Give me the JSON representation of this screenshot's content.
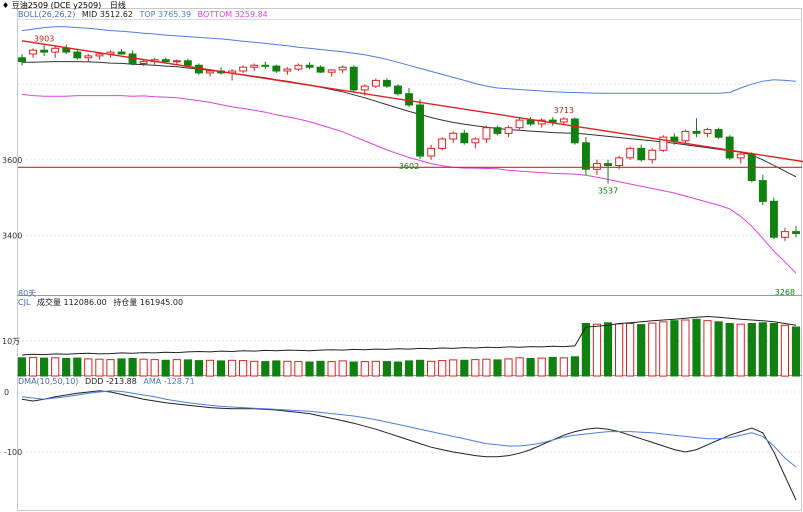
{
  "header": {
    "symbol": "♦ 豆油2509 (DCE y2509)",
    "period": "日线",
    "colors": {
      "black": "#222222"
    }
  },
  "panes": {
    "main": {
      "indicator_name": "BOLL(26,26,2)",
      "mid_label": "MID 3512.62",
      "top_label": "TOP 3765.39",
      "bottom_label": "BOTTOM 3259.84",
      "y_ticks": [
        3600,
        3400
      ],
      "ylim": [
        3250,
        3970
      ],
      "annotations": [
        {
          "text": "3903",
          "index": 2,
          "value": 3903
        },
        {
          "text": "3713",
          "index": 49,
          "value": 3713
        },
        {
          "text": "3602",
          "index": 35,
          "value": 3602
        },
        {
          "text": "3537",
          "index": 53,
          "value": 3537
        },
        {
          "text": "3268",
          "index": 69,
          "value": 3268
        }
      ],
      "horizontal_line_value": 3580,
      "trendline": {
        "start": [
          0,
          3915
        ],
        "end": [
          70,
          3595
        ]
      },
      "corner_label": "80天",
      "colors": {
        "mid": "#333333",
        "top": "#4a7fe0",
        "bottom": "#e040e0",
        "up": "#e02020",
        "down": "#108010",
        "line": "#e02020"
      }
    },
    "volume": {
      "indicator_name": "CJL",
      "vol_label": "成交量 112086.00",
      "oi_label": "持仓量 161945.00",
      "y_tick": "10万",
      "ylim": [
        0,
        200000
      ]
    },
    "dma": {
      "indicator_name": "DMA(10,50,10)",
      "ddd_label": "DDD -213.88",
      "ama_label": "AMA -128.71",
      "y_ticks": [
        0,
        -100
      ],
      "ylim": [
        -200,
        10
      ],
      "colors": {
        "ddd": "#222222",
        "ama": "#4a7fe0"
      }
    }
  },
  "chart_data": {
    "type": "candlestick",
    "candles": [
      [
        3870,
        3880,
        3850,
        3860
      ],
      [
        3880,
        3895,
        3870,
        3890
      ],
      [
        3890,
        3903,
        3875,
        3885
      ],
      [
        3885,
        3900,
        3870,
        3895
      ],
      [
        3895,
        3905,
        3880,
        3885
      ],
      [
        3885,
        3892,
        3865,
        3870
      ],
      [
        3870,
        3880,
        3860,
        3875
      ],
      [
        3875,
        3885,
        3865,
        3880
      ],
      [
        3880,
        3890,
        3870,
        3885
      ],
      [
        3885,
        3892,
        3878,
        3880
      ],
      [
        3880,
        3890,
        3850,
        3855
      ],
      [
        3855,
        3865,
        3848,
        3860
      ],
      [
        3860,
        3870,
        3852,
        3865
      ],
      [
        3865,
        3870,
        3855,
        3860
      ],
      [
        3860,
        3865,
        3850,
        3862
      ],
      [
        3862,
        3868,
        3845,
        3850
      ],
      [
        3850,
        3855,
        3825,
        3830
      ],
      [
        3830,
        3840,
        3820,
        3835
      ],
      [
        3835,
        3845,
        3825,
        3830
      ],
      [
        3830,
        3840,
        3810,
        3835
      ],
      [
        3835,
        3850,
        3830,
        3845
      ],
      [
        3845,
        3855,
        3835,
        3850
      ],
      [
        3850,
        3860,
        3840,
        3848
      ],
      [
        3848,
        3852,
        3830,
        3835
      ],
      [
        3835,
        3845,
        3825,
        3840
      ],
      [
        3840,
        3855,
        3835,
        3850
      ],
      [
        3850,
        3858,
        3840,
        3845
      ],
      [
        3845,
        3850,
        3830,
        3832
      ],
      [
        3832,
        3840,
        3820,
        3838
      ],
      [
        3838,
        3850,
        3830,
        3845
      ],
      [
        3845,
        3850,
        3780,
        3785
      ],
      [
        3785,
        3800,
        3770,
        3795
      ],
      [
        3795,
        3815,
        3790,
        3810
      ],
      [
        3810,
        3815,
        3790,
        3795
      ],
      [
        3795,
        3800,
        3770,
        3775
      ],
      [
        3775,
        3790,
        3740,
        3745
      ],
      [
        3745,
        3760,
        3602,
        3610
      ],
      [
        3610,
        3640,
        3600,
        3630
      ],
      [
        3630,
        3660,
        3625,
        3655
      ],
      [
        3655,
        3675,
        3645,
        3670
      ],
      [
        3670,
        3680,
        3640,
        3645
      ],
      [
        3645,
        3660,
        3630,
        3655
      ],
      [
        3655,
        3690,
        3645,
        3685
      ],
      [
        3685,
        3690,
        3665,
        3670
      ],
      [
        3670,
        3690,
        3660,
        3685
      ],
      [
        3685,
        3710,
        3680,
        3705
      ],
      [
        3705,
        3713,
        3690,
        3695
      ],
      [
        3695,
        3710,
        3685,
        3705
      ],
      [
        3705,
        3713,
        3690,
        3700
      ],
      [
        3700,
        3713,
        3695,
        3708
      ],
      [
        3708,
        3712,
        3640,
        3645
      ],
      [
        3645,
        3660,
        3560,
        3575
      ],
      [
        3575,
        3600,
        3560,
        3590
      ],
      [
        3590,
        3600,
        3537,
        3585
      ],
      [
        3585,
        3610,
        3575,
        3605
      ],
      [
        3605,
        3635,
        3600,
        3630
      ],
      [
        3630,
        3640,
        3595,
        3600
      ],
      [
        3600,
        3630,
        3590,
        3625
      ],
      [
        3625,
        3665,
        3620,
        3660
      ],
      [
        3660,
        3670,
        3640,
        3650
      ],
      [
        3650,
        3680,
        3640,
        3675
      ],
      [
        3675,
        3710,
        3660,
        3670
      ],
      [
        3670,
        3685,
        3660,
        3680
      ],
      [
        3680,
        3685,
        3655,
        3660
      ],
      [
        3660,
        3665,
        3600,
        3605
      ],
      [
        3605,
        3620,
        3590,
        3615
      ],
      [
        3615,
        3620,
        3540,
        3545
      ],
      [
        3545,
        3560,
        3480,
        3490
      ],
      [
        3490,
        3500,
        3390,
        3395
      ],
      [
        3395,
        3420,
        3385,
        3410
      ],
      [
        3410,
        3425,
        3395,
        3405
      ]
    ],
    "boll_mid": [
      3858,
      3858,
      3859,
      3860,
      3860,
      3860,
      3859,
      3858,
      3856,
      3855,
      3853,
      3852,
      3850,
      3848,
      3846,
      3843,
      3840,
      3837,
      3833,
      3829,
      3825,
      3821,
      3817,
      3812,
      3808,
      3803,
      3798,
      3792,
      3786,
      3780,
      3772,
      3764,
      3755,
      3746,
      3737,
      3728,
      3720,
      3712,
      3705,
      3699,
      3694,
      3690,
      3686,
      3683,
      3680,
      3678,
      3676,
      3674,
      3672,
      3671,
      3670,
      3668,
      3665,
      3662,
      3659,
      3656,
      3653,
      3650,
      3647,
      3644,
      3640,
      3636,
      3632,
      3628,
      3624,
      3620,
      3612,
      3600,
      3585,
      3570,
      3555
    ],
    "boll_top": [
      3942,
      3946,
      3950,
      3952,
      3952,
      3950,
      3948,
      3945,
      3942,
      3940,
      3938,
      3935,
      3933,
      3930,
      3928,
      3926,
      3924,
      3922,
      3920,
      3917,
      3914,
      3911,
      3908,
      3905,
      3902,
      3898,
      3895,
      3892,
      3889,
      3886,
      3882,
      3878,
      3872,
      3866,
      3858,
      3850,
      3842,
      3834,
      3826,
      3818,
      3810,
      3802,
      3795,
      3790,
      3788,
      3786,
      3784,
      3782,
      3780,
      3779,
      3778,
      3777,
      3776,
      3776,
      3776,
      3776,
      3776,
      3776,
      3776,
      3776,
      3776,
      3776,
      3776,
      3776,
      3778,
      3790,
      3800,
      3808,
      3812,
      3810,
      3808
    ],
    "boll_bottom": [
      3773,
      3770,
      3768,
      3768,
      3768,
      3770,
      3770,
      3770,
      3770,
      3770,
      3768,
      3769,
      3767,
      3766,
      3764,
      3760,
      3756,
      3752,
      3746,
      3740,
      3736,
      3731,
      3726,
      3719,
      3714,
      3708,
      3701,
      3692,
      3683,
      3674,
      3662,
      3650,
      3638,
      3626,
      3616,
      3606,
      3598,
      3590,
      3584,
      3580,
      3578,
      3578,
      3577,
      3576,
      3572,
      3570,
      3568,
      3566,
      3564,
      3563,
      3562,
      3559,
      3554,
      3548,
      3542,
      3536,
      3530,
      3524,
      3518,
      3512,
      3504,
      3496,
      3488,
      3480,
      3470,
      3450,
      3424,
      3392,
      3358,
      3330,
      3300
    ],
    "volume": [
      52000,
      53000,
      51000,
      52000,
      50000,
      51000,
      49000,
      48000,
      47000,
      49000,
      50000,
      48000,
      47000,
      45000,
      47000,
      46000,
      44000,
      45000,
      43000,
      45000,
      44000,
      42000,
      41000,
      43000,
      42000,
      41000,
      40000,
      42000,
      41000,
      43000,
      40000,
      41000,
      42000,
      41000,
      40000,
      43000,
      45000,
      42000,
      44000,
      46000,
      45000,
      47000,
      48000,
      46000,
      49000,
      52000,
      50000,
      51000,
      53000,
      52000,
      55000,
      150000,
      148000,
      152000,
      149000,
      150000,
      147000,
      151000,
      155000,
      158000,
      160000,
      162000,
      158000,
      155000,
      150000,
      148000,
      150000,
      152000,
      150000,
      145000,
      140000
    ],
    "open_interest": [
      60000,
      62000,
      61000,
      63000,
      62000,
      64000,
      65000,
      63000,
      64000,
      66000,
      65000,
      67000,
      66000,
      68000,
      67000,
      69000,
      70000,
      69000,
      71000,
      70000,
      72000,
      71000,
      73000,
      72000,
      74000,
      73000,
      72000,
      74000,
      75000,
      74000,
      76000,
      75000,
      77000,
      76000,
      78000,
      77000,
      79000,
      78000,
      80000,
      79000,
      81000,
      80000,
      82000,
      81000,
      83000,
      82000,
      84000,
      83000,
      85000,
      84000,
      86000,
      140000,
      142000,
      145000,
      150000,
      152000,
      155000,
      158000,
      160000,
      162000,
      165000,
      168000,
      170000,
      168000,
      165000,
      162000,
      160000,
      158000,
      155000,
      150000,
      145000
    ],
    "ddd": [
      -12,
      -15,
      -12,
      -8,
      -5,
      -2,
      0,
      2,
      0,
      -4,
      -8,
      -12,
      -15,
      -18,
      -20,
      -22,
      -24,
      -26,
      -27,
      -28,
      -28,
      -28,
      -29,
      -30,
      -32,
      -34,
      -36,
      -40,
      -44,
      -48,
      -52,
      -57,
      -62,
      -68,
      -74,
      -80,
      -86,
      -92,
      -96,
      -100,
      -103,
      -106,
      -108,
      -108,
      -106,
      -102,
      -96,
      -88,
      -80,
      -72,
      -66,
      -62,
      -60,
      -62,
      -66,
      -72,
      -78,
      -84,
      -90,
      -96,
      -100,
      -96,
      -88,
      -80,
      -72,
      -66,
      -60,
      -68,
      -100,
      -140,
      -180
    ],
    "ama": [
      -8,
      -10,
      -12,
      -10,
      -8,
      -5,
      -2,
      0,
      2,
      1,
      -2,
      -5,
      -8,
      -12,
      -15,
      -18,
      -20,
      -22,
      -24,
      -25,
      -26,
      -27,
      -28,
      -29,
      -30,
      -31,
      -32,
      -34,
      -36,
      -38,
      -40,
      -43,
      -46,
      -50,
      -54,
      -58,
      -62,
      -66,
      -70,
      -74,
      -78,
      -82,
      -86,
      -88,
      -90,
      -90,
      -88,
      -85,
      -80,
      -75,
      -72,
      -70,
      -68,
      -66,
      -66,
      -66,
      -67,
      -68,
      -70,
      -72,
      -74,
      -76,
      -78,
      -78,
      -76,
      -72,
      -68,
      -74,
      -90,
      -110,
      -125
    ]
  }
}
